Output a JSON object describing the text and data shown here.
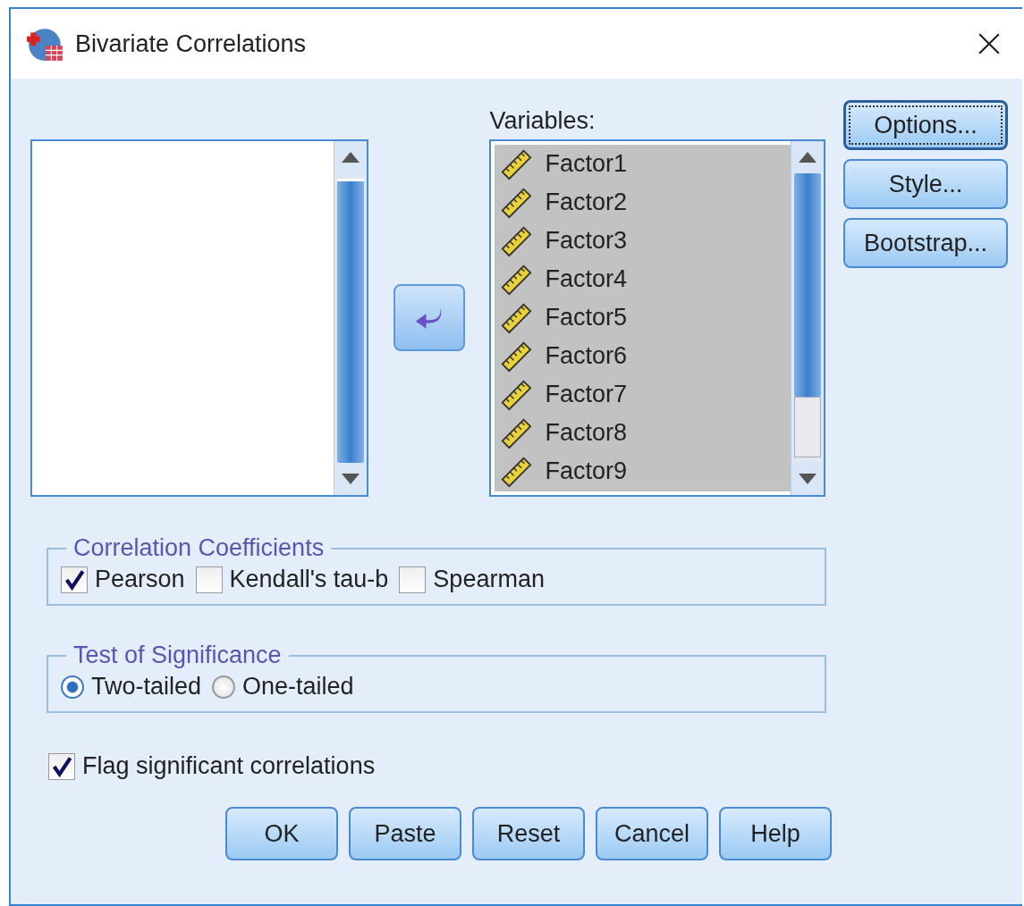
{
  "window": {
    "title": "Bivariate Correlations"
  },
  "variables": {
    "label": "Variables:",
    "items": [
      {
        "name": "Factor1",
        "selected": true
      },
      {
        "name": "Factor2",
        "selected": true
      },
      {
        "name": "Factor3",
        "selected": true
      },
      {
        "name": "Factor4",
        "selected": true
      },
      {
        "name": "Factor5",
        "selected": true
      },
      {
        "name": "Factor6",
        "selected": true
      },
      {
        "name": "Factor7",
        "selected": true
      },
      {
        "name": "Factor8",
        "selected": true
      },
      {
        "name": "Factor9",
        "selected": true
      }
    ]
  },
  "side_buttons": [
    {
      "label": "Options...",
      "focused": true
    },
    {
      "label": "Style...",
      "focused": false
    },
    {
      "label": "Bootstrap...",
      "focused": false
    }
  ],
  "correlation_coefficients": {
    "title": "Correlation Coefficients",
    "options": [
      {
        "label": "Pearson",
        "checked": true
      },
      {
        "label": "Kendall's tau-b",
        "checked": false
      },
      {
        "label": "Spearman",
        "checked": false
      }
    ]
  },
  "test_of_significance": {
    "title": "Test of Significance",
    "options": [
      {
        "label": "Two-tailed",
        "selected": true
      },
      {
        "label": "One-tailed",
        "selected": false
      }
    ]
  },
  "flag": {
    "label": "Flag significant correlations",
    "checked": true
  },
  "buttons": [
    "OK",
    "Paste",
    "Reset",
    "Cancel",
    "Help"
  ]
}
